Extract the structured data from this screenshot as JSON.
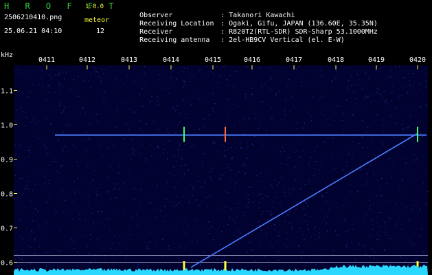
{
  "app": {
    "title": "H R O F F T",
    "version": "1.0.0"
  },
  "file_name": "2506210410.png",
  "datetime": "25.06.21 04:10",
  "meteor": {
    "label": "meteor",
    "count": "12"
  },
  "info": [
    {
      "label": "Observer",
      "value": ": Takanori Kawachi"
    },
    {
      "label": "Receiving Location",
      "value": ": Ogaki, Gifu, JAPAN (136.60E, 35.35N)"
    },
    {
      "label": "Receiver",
      "value": ": R820T2(RTL-SDR) SDR-Sharp 53.1000MHz"
    },
    {
      "label": "Receiving antenna",
      "value": ": 2el-HB9CV Vertical (el. E-W)"
    }
  ],
  "chart_data": {
    "type": "heatmap",
    "ylabel": "kHz",
    "x_ticks": [
      "0411",
      "0412",
      "0413",
      "0414",
      "0415",
      "0416",
      "0417",
      "0418",
      "0419",
      "0420"
    ],
    "y_ticks": [
      "1.1",
      "1.0",
      "0.9",
      "0.8",
      "0.7",
      "0.6"
    ],
    "ylim": [
      0.58,
      1.15
    ],
    "carrier_khz": 0.97,
    "reference_lines_khz": [
      0.62,
      0.6
    ],
    "meteor_echo_times": [
      "04:14:20",
      "04:15:20",
      "04:20:00"
    ],
    "sweep_trace": {
      "start": {
        "time": "04:14:30",
        "khz": 0.585
      },
      "end": {
        "time": "04:20:00",
        "khz": 0.975
      }
    },
    "colors": {
      "background": "#020230",
      "carrier": "#4a7cff",
      "echo": "#ff6a3d",
      "echo_green": "#3cff6a",
      "tick": "#ffff3a",
      "lines": "#b8b8d8",
      "baseline": "#2ad8ff"
    }
  }
}
